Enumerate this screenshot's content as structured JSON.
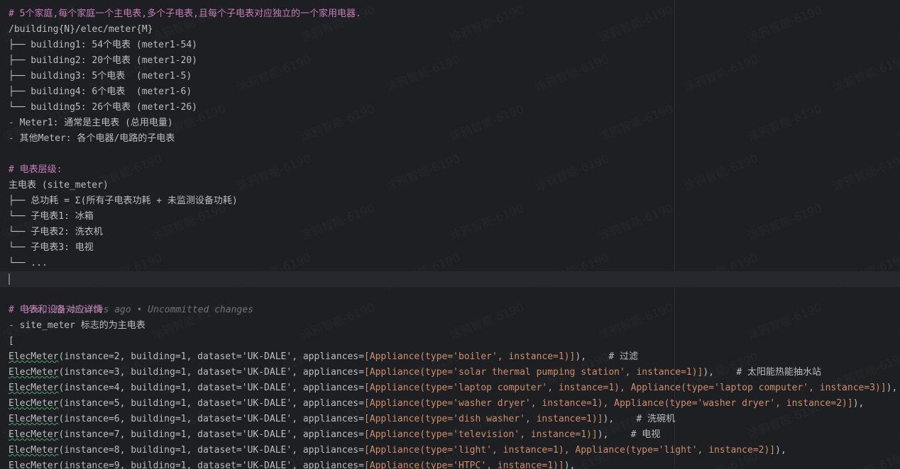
{
  "lines": {
    "l1": "# 5个家庭,每个家庭一个主电表,多个子电表,且每个子电表对应独立的一个家用电器.",
    "l2": "/building{N}/elec/meter{M}",
    "l3": "├── building1: 54个电表 (meter1-54)",
    "l4": "├── building2: 20个电表 (meter1-20)",
    "l5": "├── building3: 5个电表  (meter1-5)",
    "l6": "├── building4: 6个电表  (meter1-6)",
    "l7": "└── building5: 26个电表 (meter1-26)",
    "l8_dash": "-",
    "l8_text": " Meter1: 通常是主电表 (总用电量)",
    "l9_dash": "-",
    "l9_text": " 其他Meter: 各个电器/电路的子电表",
    "l10": "# 电表层级:",
    "l11": "主电表 (site_meter)",
    "l12": "├── 总功耗 = Σ(所有子电表功耗 + 未监测设备功耗)",
    "l13": "└── 子电表1: 冰箱",
    "l14": "└── 子电表2: 洗衣机",
    "l15": "└── 子电表3: 电视",
    "l16": "└── ...",
    "l17": "# 电表和设备对应详情",
    "l18_dash": "-",
    "l18_text": " site_meter 标志的为主电表",
    "l19": "["
  },
  "blame": {
    "text": "You, 19 minutes ago • Uncommitted changes"
  },
  "code": {
    "class_name": "ElecMeter",
    "prefix_tail": "(instance=",
    "building_part": ", building=1, dataset=",
    "dataset_str": "'UK-DALE'",
    "appl_kw": ", appliances=",
    "rows": [
      {
        "inst": "2",
        "apps": "[Appliance(type='boiler', instance=1)]",
        "end": "),",
        "comment": "    # 过滤"
      },
      {
        "inst": "3",
        "apps": "[Appliance(type='solar thermal pumping station', instance=1)]",
        "end": "),",
        "comment": "    # 太阳能热能抽水站"
      },
      {
        "inst": "4",
        "apps": "[Appliance(type='laptop computer', instance=1), Appliance(type='laptop computer', instance=3)]",
        "end": "),",
        "comment": ""
      },
      {
        "inst": "5",
        "apps": "[Appliance(type='washer dryer', instance=1), Appliance(type='washer dryer', instance=2)]",
        "end": "),",
        "comment": ""
      },
      {
        "inst": "6",
        "apps": "[Appliance(type='dish washer', instance=1)]",
        "end": "),",
        "comment": "    # 洗碗机"
      },
      {
        "inst": "7",
        "apps": "[Appliance(type='television', instance=1)]",
        "end": "),",
        "comment": "    # 电视"
      },
      {
        "inst": "8",
        "apps": "[Appliance(type='light', instance=1), Appliance(type='light', instance=2)]",
        "end": "),",
        "comment": ""
      },
      {
        "inst": "9",
        "apps": "[Appliance(type='HTPC', instance=1)]",
        "end": "),",
        "comment": ""
      }
    ]
  },
  "watermark": "涂鸦智能-6190"
}
